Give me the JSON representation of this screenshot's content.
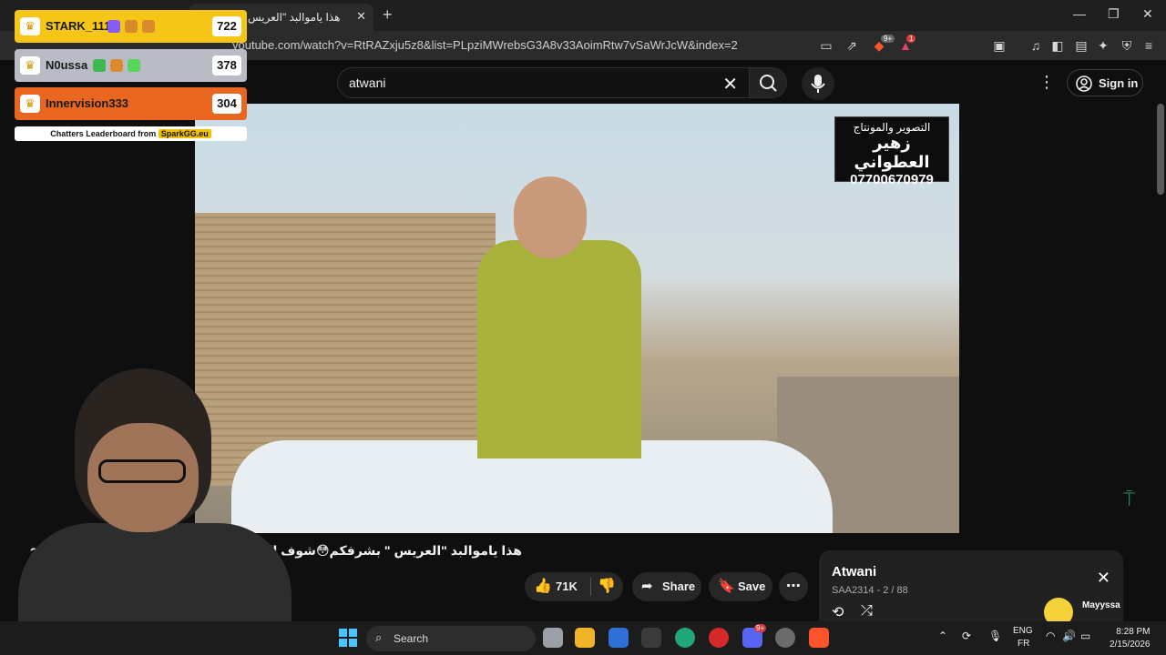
{
  "browser": {
    "tab_title": "هذا ياموالبد \"العريس \" بشرفكم",
    "tab_close": "✕",
    "new_tab": "+",
    "url": "youtube.com/watch?v=RtRAZxju5z8&list=PLpziMWrebsG3A8v33AoimRtw7vSaWrJcW&index=2",
    "shields_count": "9+",
    "rewards_count": "1",
    "window_controls": [
      "—",
      "❐",
      "✕"
    ]
  },
  "youtube": {
    "search_value": "atwani",
    "sign_in": "Sign in",
    "video_title": "هذا ياموالبد \"العريس \" بشرفكم😳شوف العراس العر",
    "title_prefix": "20",
    "likes": "71K",
    "share": "Share",
    "save": "Save",
    "watermark": {
      "line1": "التصوير والمونتاج",
      "line2": "زهير العطواني",
      "phone": "07700670979"
    }
  },
  "playlist": {
    "title": "Atwani",
    "subtitle": "SAA2314 - 2 / 88"
  },
  "leaderboard": {
    "rows": [
      {
        "name": "STARK_111",
        "score": "722",
        "color": "#f5c518",
        "text": "#1a1a1a"
      },
      {
        "name": "N0ussa",
        "score": "378",
        "color": "#b9bcc4",
        "text": "#1a1a1a"
      },
      {
        "name": "Innervision333",
        "score": "304",
        "color": "#e8661f",
        "text": "#1a1a1a"
      }
    ],
    "footer": "Chatters Leaderboard from",
    "brand": "SparkGG.eu"
  },
  "taskbar": {
    "search": "Search",
    "lang_top": "ENG",
    "lang_bottom": "FR",
    "time": "8:28 PM",
    "date": "2/15/2026",
    "discord_badge": "9+"
  },
  "follower": {
    "name": "Mayyssa"
  },
  "colors": {
    "accent": "#ff0000",
    "background": "#0f0f0f",
    "panel": "#212121"
  }
}
